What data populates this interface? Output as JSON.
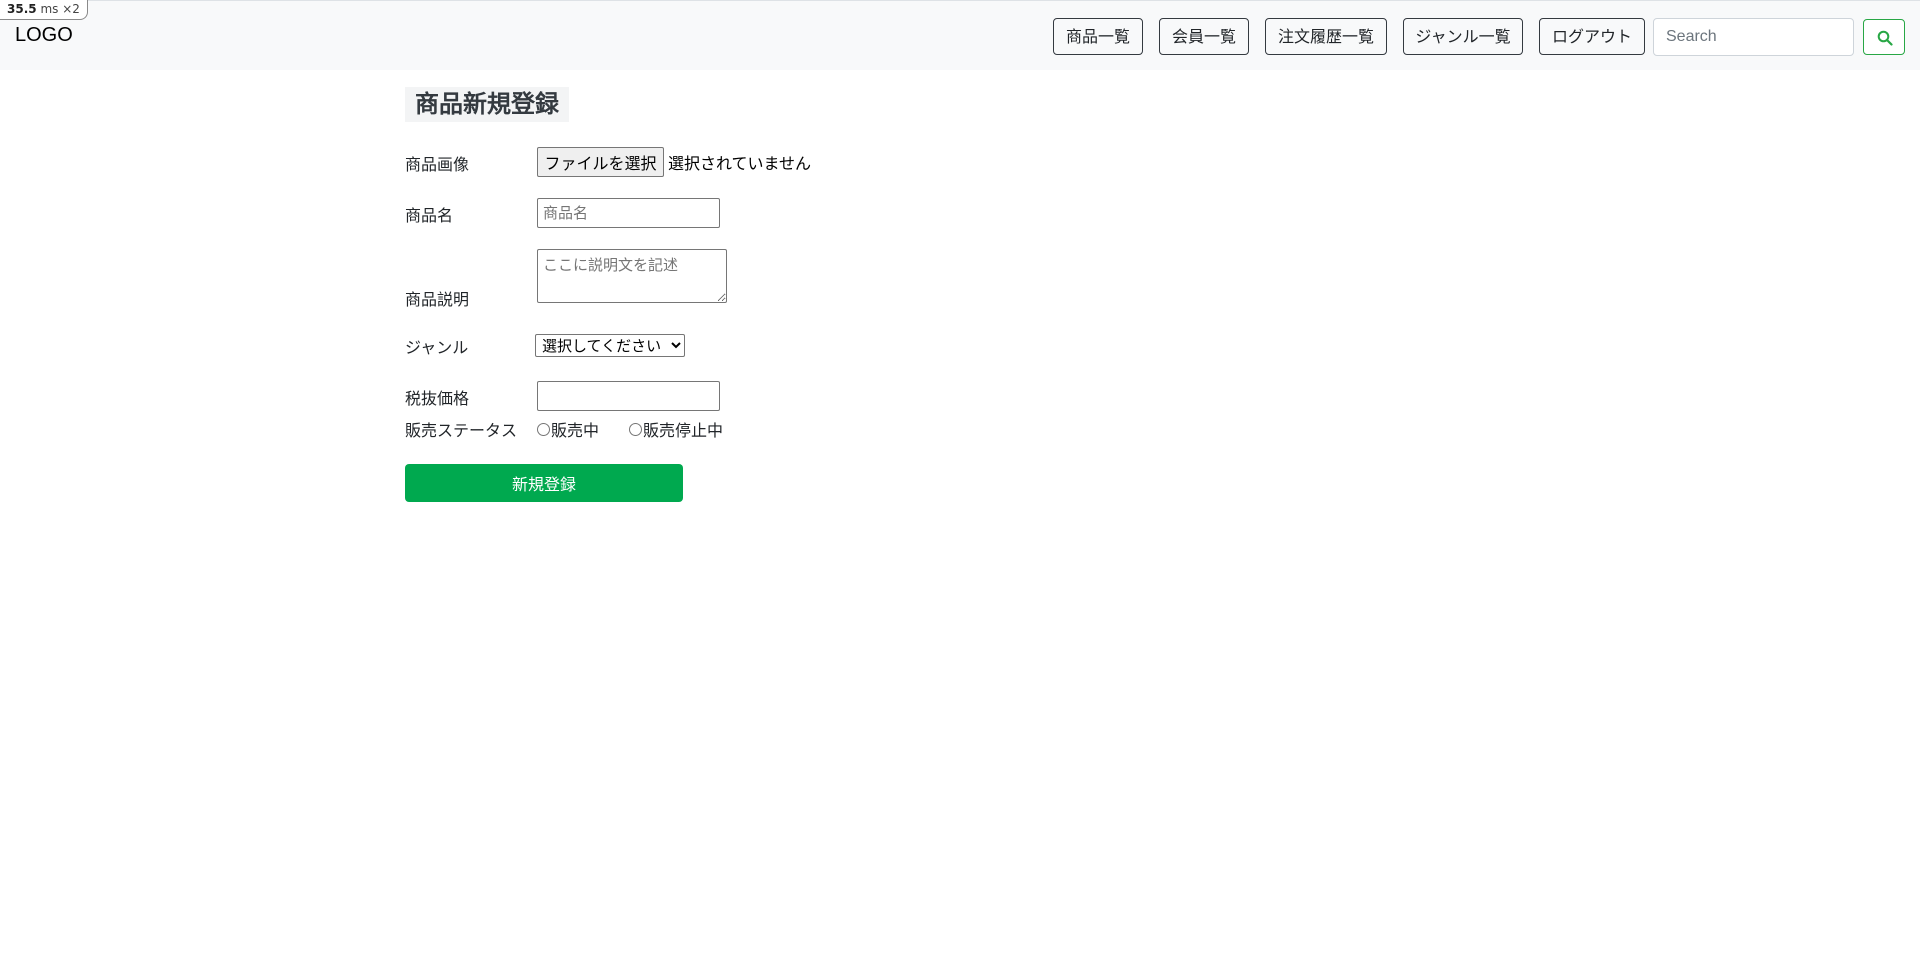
{
  "perf": {
    "value": "35.5",
    "unit": "ms ×2"
  },
  "navbar": {
    "brand": "LOGO",
    "links": [
      "商品一覧",
      "会員一覧",
      "注文履歴一覧",
      "ジャンル一覧",
      "ログアウト"
    ],
    "search": {
      "placeholder": "Search",
      "value": ""
    },
    "search_icon": "search-icon",
    "accent_color": "#28a745"
  },
  "form": {
    "title": "商品新規登録",
    "image": {
      "label": "商品画像",
      "button": "ファイルを選択",
      "status": "選択されていません"
    },
    "name": {
      "label": "商品名",
      "placeholder": "商品名",
      "value": ""
    },
    "description": {
      "label": "商品説明",
      "placeholder": "ここに説明文を記述",
      "value": ""
    },
    "genre": {
      "label": "ジャンル",
      "selected": "選択してください"
    },
    "price": {
      "label": "税抜価格",
      "value": ""
    },
    "status": {
      "label": "販売ステータス",
      "options": [
        "販売中",
        "販売停止中"
      ]
    },
    "submit": {
      "label": "新規登録",
      "color": "#00a94f"
    }
  }
}
